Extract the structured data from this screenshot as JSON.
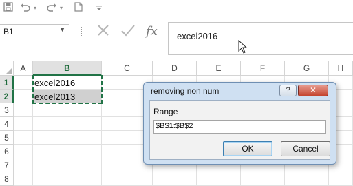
{
  "qat": {
    "icons": [
      "save-icon",
      "undo-icon",
      "undo-dropdown-icon",
      "redo-icon",
      "redo-dropdown-icon",
      "new-document-icon",
      "customize-toolbar-icon"
    ]
  },
  "formula_bar": {
    "name_box": "B1",
    "formula": "excel2016",
    "fx_label": "fx"
  },
  "sheet": {
    "columns": [
      "A",
      "B",
      "C",
      "D",
      "E",
      "F",
      "G",
      "H"
    ],
    "rows": [
      "1",
      "2",
      "3",
      "4",
      "5",
      "6",
      "7",
      "8"
    ],
    "selected_column": "B",
    "cells": {
      "B1": "excel2016",
      "B2": "excel2013"
    }
  },
  "dialog": {
    "title": "removing non num",
    "help_label": "?",
    "close_label": "✕",
    "field_label": "Range",
    "range_value": "$B$1:$B$2",
    "ok_label": "OK",
    "cancel_label": "Cancel"
  },
  "colors": {
    "excel_green": "#217346",
    "dialog_frame": "#cfe0f2",
    "close_red": "#c4442f",
    "selection_fill": "#d0d0d0"
  }
}
